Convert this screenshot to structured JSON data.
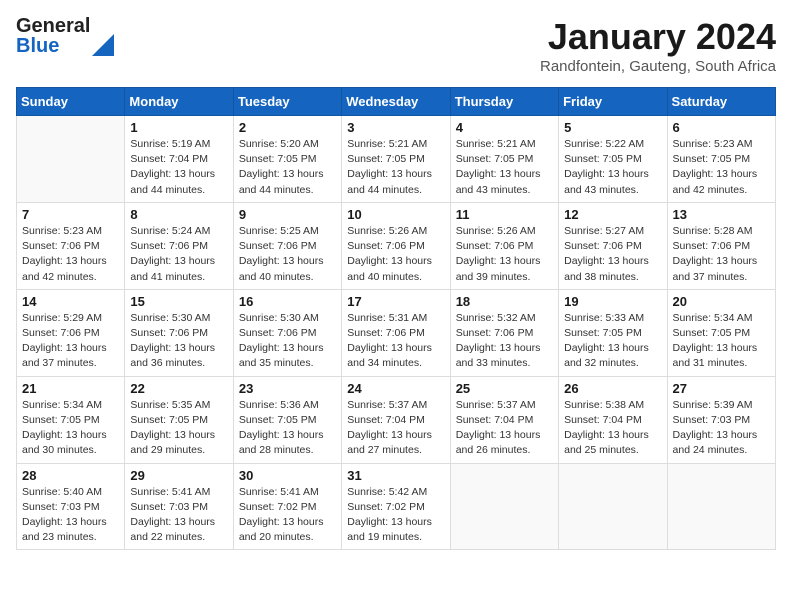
{
  "header": {
    "logo_general": "General",
    "logo_blue": "Blue",
    "month_title": "January 2024",
    "location": "Randfontein, Gauteng, South Africa"
  },
  "days_of_week": [
    "Sunday",
    "Monday",
    "Tuesday",
    "Wednesday",
    "Thursday",
    "Friday",
    "Saturday"
  ],
  "weeks": [
    [
      {
        "day": "",
        "info": ""
      },
      {
        "day": "1",
        "info": "Sunrise: 5:19 AM\nSunset: 7:04 PM\nDaylight: 13 hours\nand 44 minutes."
      },
      {
        "day": "2",
        "info": "Sunrise: 5:20 AM\nSunset: 7:05 PM\nDaylight: 13 hours\nand 44 minutes."
      },
      {
        "day": "3",
        "info": "Sunrise: 5:21 AM\nSunset: 7:05 PM\nDaylight: 13 hours\nand 44 minutes."
      },
      {
        "day": "4",
        "info": "Sunrise: 5:21 AM\nSunset: 7:05 PM\nDaylight: 13 hours\nand 43 minutes."
      },
      {
        "day": "5",
        "info": "Sunrise: 5:22 AM\nSunset: 7:05 PM\nDaylight: 13 hours\nand 43 minutes."
      },
      {
        "day": "6",
        "info": "Sunrise: 5:23 AM\nSunset: 7:05 PM\nDaylight: 13 hours\nand 42 minutes."
      }
    ],
    [
      {
        "day": "7",
        "info": "Sunrise: 5:23 AM\nSunset: 7:06 PM\nDaylight: 13 hours\nand 42 minutes."
      },
      {
        "day": "8",
        "info": "Sunrise: 5:24 AM\nSunset: 7:06 PM\nDaylight: 13 hours\nand 41 minutes."
      },
      {
        "day": "9",
        "info": "Sunrise: 5:25 AM\nSunset: 7:06 PM\nDaylight: 13 hours\nand 40 minutes."
      },
      {
        "day": "10",
        "info": "Sunrise: 5:26 AM\nSunset: 7:06 PM\nDaylight: 13 hours\nand 40 minutes."
      },
      {
        "day": "11",
        "info": "Sunrise: 5:26 AM\nSunset: 7:06 PM\nDaylight: 13 hours\nand 39 minutes."
      },
      {
        "day": "12",
        "info": "Sunrise: 5:27 AM\nSunset: 7:06 PM\nDaylight: 13 hours\nand 38 minutes."
      },
      {
        "day": "13",
        "info": "Sunrise: 5:28 AM\nSunset: 7:06 PM\nDaylight: 13 hours\nand 37 minutes."
      }
    ],
    [
      {
        "day": "14",
        "info": "Sunrise: 5:29 AM\nSunset: 7:06 PM\nDaylight: 13 hours\nand 37 minutes."
      },
      {
        "day": "15",
        "info": "Sunrise: 5:30 AM\nSunset: 7:06 PM\nDaylight: 13 hours\nand 36 minutes."
      },
      {
        "day": "16",
        "info": "Sunrise: 5:30 AM\nSunset: 7:06 PM\nDaylight: 13 hours\nand 35 minutes."
      },
      {
        "day": "17",
        "info": "Sunrise: 5:31 AM\nSunset: 7:06 PM\nDaylight: 13 hours\nand 34 minutes."
      },
      {
        "day": "18",
        "info": "Sunrise: 5:32 AM\nSunset: 7:06 PM\nDaylight: 13 hours\nand 33 minutes."
      },
      {
        "day": "19",
        "info": "Sunrise: 5:33 AM\nSunset: 7:05 PM\nDaylight: 13 hours\nand 32 minutes."
      },
      {
        "day": "20",
        "info": "Sunrise: 5:34 AM\nSunset: 7:05 PM\nDaylight: 13 hours\nand 31 minutes."
      }
    ],
    [
      {
        "day": "21",
        "info": "Sunrise: 5:34 AM\nSunset: 7:05 PM\nDaylight: 13 hours\nand 30 minutes."
      },
      {
        "day": "22",
        "info": "Sunrise: 5:35 AM\nSunset: 7:05 PM\nDaylight: 13 hours\nand 29 minutes."
      },
      {
        "day": "23",
        "info": "Sunrise: 5:36 AM\nSunset: 7:05 PM\nDaylight: 13 hours\nand 28 minutes."
      },
      {
        "day": "24",
        "info": "Sunrise: 5:37 AM\nSunset: 7:04 PM\nDaylight: 13 hours\nand 27 minutes."
      },
      {
        "day": "25",
        "info": "Sunrise: 5:37 AM\nSunset: 7:04 PM\nDaylight: 13 hours\nand 26 minutes."
      },
      {
        "day": "26",
        "info": "Sunrise: 5:38 AM\nSunset: 7:04 PM\nDaylight: 13 hours\nand 25 minutes."
      },
      {
        "day": "27",
        "info": "Sunrise: 5:39 AM\nSunset: 7:03 PM\nDaylight: 13 hours\nand 24 minutes."
      }
    ],
    [
      {
        "day": "28",
        "info": "Sunrise: 5:40 AM\nSunset: 7:03 PM\nDaylight: 13 hours\nand 23 minutes."
      },
      {
        "day": "29",
        "info": "Sunrise: 5:41 AM\nSunset: 7:03 PM\nDaylight: 13 hours\nand 22 minutes."
      },
      {
        "day": "30",
        "info": "Sunrise: 5:41 AM\nSunset: 7:02 PM\nDaylight: 13 hours\nand 20 minutes."
      },
      {
        "day": "31",
        "info": "Sunrise: 5:42 AM\nSunset: 7:02 PM\nDaylight: 13 hours\nand 19 minutes."
      },
      {
        "day": "",
        "info": ""
      },
      {
        "day": "",
        "info": ""
      },
      {
        "day": "",
        "info": ""
      }
    ]
  ]
}
